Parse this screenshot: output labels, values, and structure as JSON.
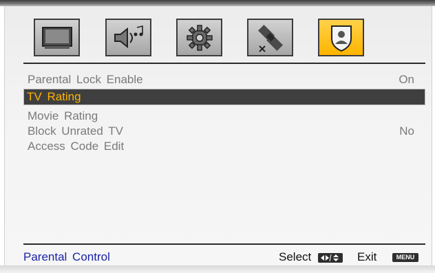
{
  "tabs": [
    {
      "id": "picture",
      "icon": "tv-icon",
      "active": false
    },
    {
      "id": "sound",
      "icon": "speaker-music-icon",
      "active": false
    },
    {
      "id": "setup",
      "icon": "gear-icon",
      "active": false
    },
    {
      "id": "channel",
      "icon": "satellite-icon",
      "active": false
    },
    {
      "id": "parental",
      "icon": "parental-shield-icon",
      "active": true
    }
  ],
  "menu": {
    "items": [
      {
        "label": "Parental Lock Enable",
        "value": "On"
      },
      {
        "label": "TV Rating",
        "value": "",
        "selected": true
      },
      {
        "label": "Movie Rating",
        "value": ""
      },
      {
        "label": "Block Unrated TV",
        "value": "No"
      },
      {
        "label": "Access Code Edit",
        "value": ""
      }
    ]
  },
  "footer": {
    "title": "Parental Control",
    "select_label": "Select",
    "exit_label": "Exit",
    "menu_key": "MENU"
  },
  "colors": {
    "highlight_bg": "#3f3f3f",
    "highlight_text": "#ffb300",
    "footer_title": "#1a22a8",
    "active_tab": "#ffc21a"
  }
}
